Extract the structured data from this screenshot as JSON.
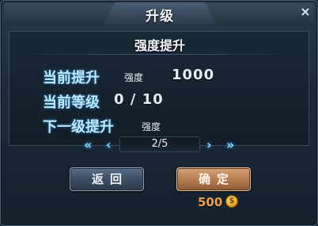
{
  "dialog": {
    "title": "升级",
    "close_glyph": "×"
  },
  "panel": {
    "subtitle": "强度提升",
    "rows": [
      {
        "label": "当前提升",
        "small": "强度",
        "value": "1000"
      },
      {
        "label": "当前等级",
        "value": "0 / 10"
      },
      {
        "label": "下一级提升",
        "small": "强度"
      }
    ]
  },
  "pager": {
    "first_glyph": "«",
    "prev_glyph": "‹",
    "page": "2/5",
    "next_glyph": "›",
    "last_glyph": "»"
  },
  "buttons": {
    "back_label": "返回",
    "confirm_label": "确定"
  },
  "cost": {
    "value": "500",
    "icon": "coin-icon"
  }
}
